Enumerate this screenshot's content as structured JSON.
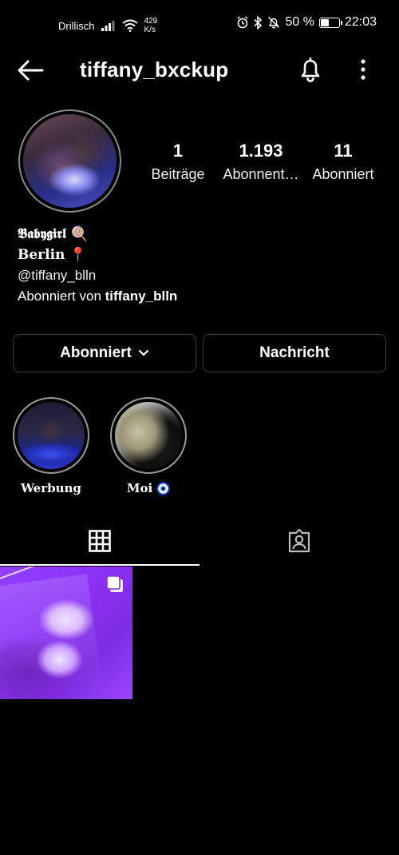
{
  "status_bar": {
    "carrier": "Drillisch",
    "speed_value": "429",
    "speed_unit": "K/s",
    "battery_text": "50 %",
    "battery_level": 0.5,
    "time": "22:03"
  },
  "header": {
    "username": "tiffany_bxckup"
  },
  "stats": [
    {
      "value": "1",
      "label": "Beiträge"
    },
    {
      "value": "1.193",
      "label": "Abonnent…"
    },
    {
      "value": "11",
      "label": "Abonniert"
    }
  ],
  "bio": {
    "line1": "𝕭𝖆𝖇𝖞𝖌𝖎𝖗𝖑 🍭",
    "line2": "𝐁𝐞𝐫𝐥𝐢𝐧 📍",
    "mention": "@tiffany_blln",
    "followed_by_prefix": "Abonniert von",
    "followed_by_user": "tiffany_blln"
  },
  "buttons": {
    "follow_label": "Abonniert",
    "message_label": "Nachricht"
  },
  "highlights": [
    {
      "label": "Werbung"
    },
    {
      "label": "Moi"
    }
  ],
  "icons": {
    "back": "back-arrow-icon",
    "bell": "bell-icon",
    "more": "more-vertical-icon",
    "grid": "grid-icon",
    "tagged": "tagged-person-icon",
    "multi": "multiple-posts-icon"
  },
  "colors": {
    "background": "#000000",
    "text": "#ffffff",
    "border": "#3b3b3b",
    "post_purple": "#8a32f5"
  }
}
